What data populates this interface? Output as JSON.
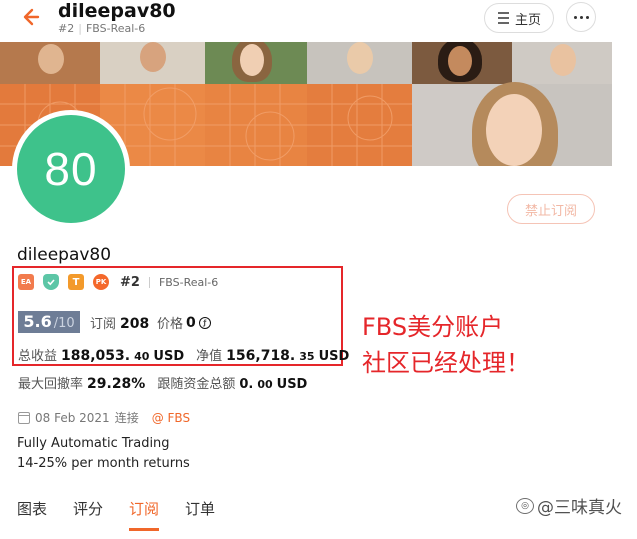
{
  "header": {
    "title": "dileepav80",
    "rank": "#2",
    "account": "FBS-Real-6",
    "home_label": "主页"
  },
  "profile": {
    "avatar_text": "80",
    "forbid_label": "禁止订阅",
    "name": "dileepav80",
    "badges": {
      "ea": "EA",
      "t": "T",
      "pk": "PK"
    },
    "rank": "#2",
    "account": "FBS-Real-6",
    "score": "5.6",
    "score_denom": "/10",
    "subs_label": "订阅",
    "subs_value": "208",
    "price_label": "价格",
    "price_value": "0",
    "total_profit_label": "总收益",
    "total_profit_int": "188,053.",
    "total_profit_dec": "40",
    "total_profit_unit": "USD",
    "equity_label": "净值",
    "equity_int": "156,718.",
    "equity_dec": "35",
    "equity_unit": "USD",
    "drawdown_label": "最大回撤率",
    "drawdown_value": "29.28%",
    "follow_label": "跟随资金总额",
    "follow_int": "0.",
    "follow_dec": "00",
    "follow_unit": "USD",
    "date": "08 Feb 2021",
    "connected_label": "连接",
    "broker_link": "@ FBS",
    "desc_line1": "Fully Automatic Trading",
    "desc_line2": "14-25% per month returns"
  },
  "annotation": {
    "line1": "FBS美分账户",
    "line2": "社区已经处理！"
  },
  "tabs": [
    {
      "label": "图表"
    },
    {
      "label": "评分"
    },
    {
      "label": "订阅"
    },
    {
      "label": "订单"
    }
  ],
  "watermark": "@三味真火",
  "colors": {
    "accent": "#f0672a",
    "avatar": "#3ec28b",
    "annotation": "#e5262a",
    "score_bg": "#6e7d96"
  }
}
